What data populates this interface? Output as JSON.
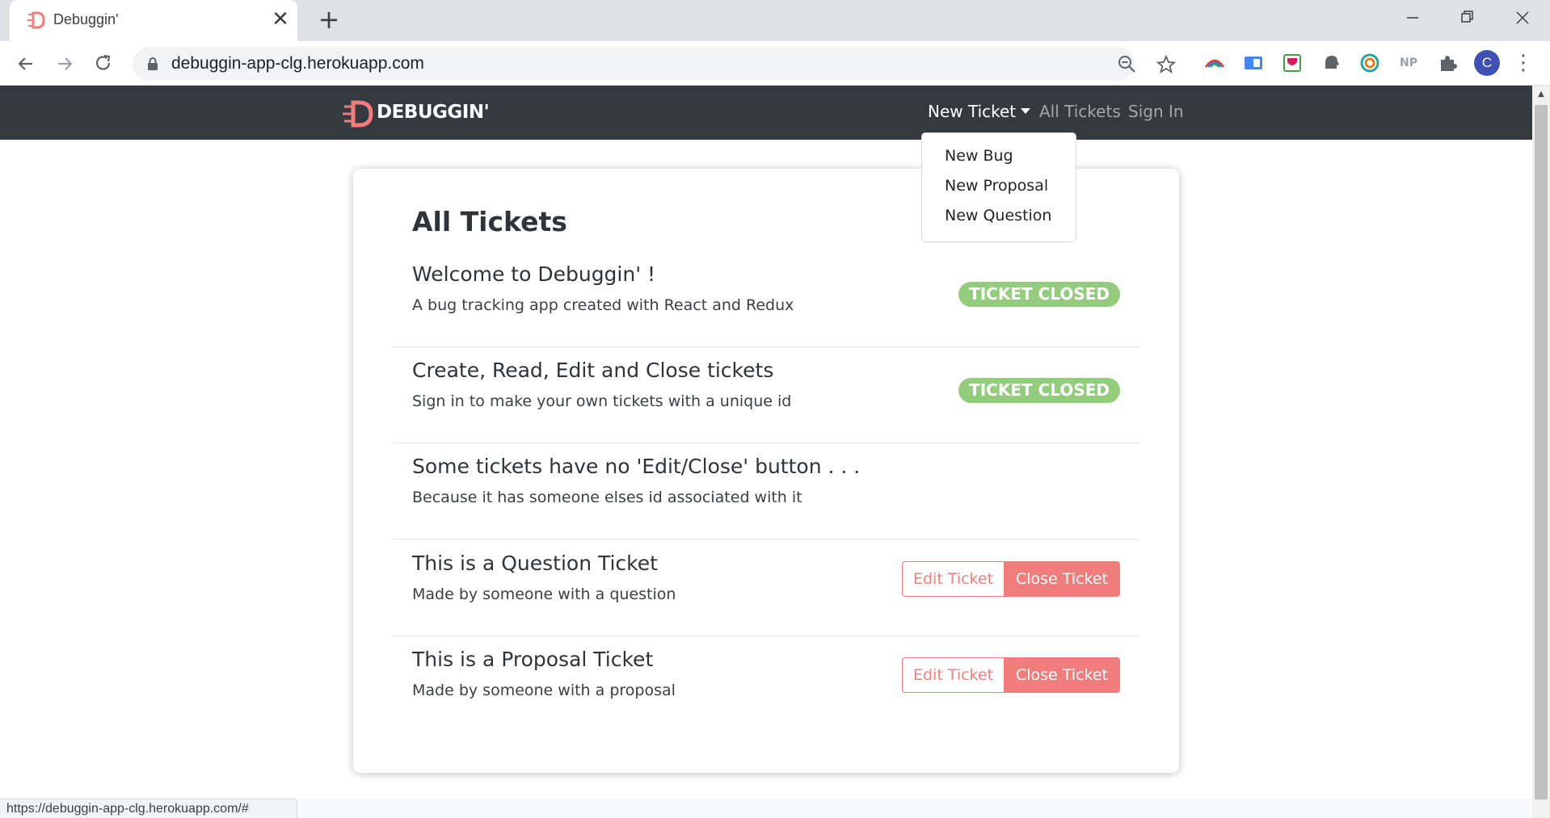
{
  "browser": {
    "tab_title": "Debuggin'",
    "tab_close": "✕",
    "new_tab": "+",
    "url": "debuggin-app-clg.herokuapp.com",
    "status_url": "https://debuggin-app-clg.herokuapp.com/#",
    "profile_initial": "C",
    "extension_np": "NP",
    "window_controls": [
      "minimize",
      "restore",
      "close"
    ]
  },
  "navbar": {
    "brand": "DEBUGGIN'",
    "links": {
      "new_ticket": "New Ticket",
      "all_tickets": "All Tickets",
      "sign_in": "Sign In"
    },
    "dropdown": [
      "New Bug",
      "New Proposal",
      "New Question"
    ]
  },
  "main": {
    "title": "All Tickets",
    "tickets": [
      {
        "title": "Welcome to Debuggin' !",
        "description": "A bug tracking app created with React and Redux",
        "status": "TICKET CLOSED"
      },
      {
        "title": "Create, Read, Edit and Close tickets",
        "description": "Sign in to make your own tickets with a unique id",
        "status": "TICKET CLOSED"
      },
      {
        "title": "Some tickets have no 'Edit/Close' button . . .",
        "description": "Because it has someone elses id associated with it"
      },
      {
        "title": "This is a Question Ticket",
        "description": "Made by someone with a question",
        "edit_label": "Edit Ticket",
        "close_label": "Close Ticket"
      },
      {
        "title": "This is a Proposal Ticket",
        "description": "Made by someone with a proposal",
        "edit_label": "Edit Ticket",
        "close_label": "Close Ticket"
      }
    ]
  },
  "colors": {
    "navbar_bg": "#343a40",
    "brand_accent": "#f07c7c",
    "closed_badge": "#92cc7c",
    "danger_button": "#f07c7c"
  }
}
